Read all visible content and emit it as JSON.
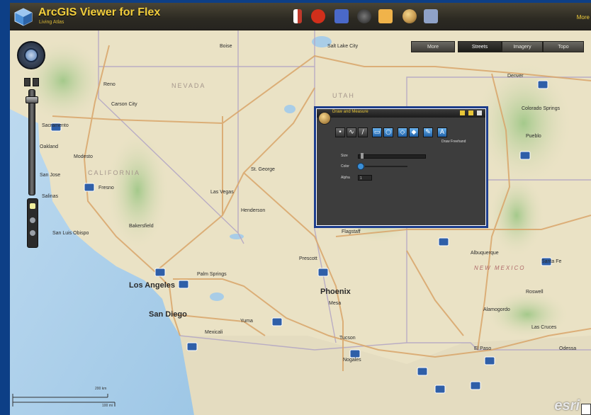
{
  "app": {
    "title": "ArcGIS Viewer for Flex",
    "subtitle": "Living Atlas",
    "header_more": "More"
  },
  "header_tools": [
    {
      "icon": "bookmark-icon",
      "color": "#c0392b"
    },
    {
      "icon": "record-icon",
      "color": "#d12f1b"
    },
    {
      "icon": "legend-icon",
      "color": "#4a69c9"
    },
    {
      "icon": "search-icon",
      "color": "#2d2d2d"
    },
    {
      "icon": "folder-icon",
      "color": "#f0b34a"
    },
    {
      "icon": "draw-globe-icon",
      "color": "#c79b52"
    },
    {
      "icon": "print-icon",
      "color": "#8fa2c8"
    }
  ],
  "basemaps": {
    "items": [
      "More",
      "Streets",
      "Imagery",
      "Topo"
    ],
    "active": "Streets"
  },
  "map_labels": [
    {
      "text": "Boise",
      "cls": "city"
    },
    {
      "text": "Salt Lake City",
      "cls": "city"
    },
    {
      "text": "Reno",
      "cls": "city"
    },
    {
      "text": "Carson City",
      "cls": "city"
    },
    {
      "text": "NEVADA",
      "cls": "state"
    },
    {
      "text": "UTAH",
      "cls": "state"
    },
    {
      "text": "Sacramento",
      "cls": "city"
    },
    {
      "text": "Oakland",
      "cls": "city"
    },
    {
      "text": "Modesto",
      "cls": "city"
    },
    {
      "text": "San Jose",
      "cls": "city"
    },
    {
      "text": "CALIFORNIA",
      "cls": "state"
    },
    {
      "text": "Fresno",
      "cls": "city"
    },
    {
      "text": "Salinas",
      "cls": "city"
    },
    {
      "text": "St. George",
      "cls": "city"
    },
    {
      "text": "Las Vegas",
      "cls": "city"
    },
    {
      "text": "Henderson",
      "cls": "city"
    },
    {
      "text": "Bakersfield",
      "cls": "city"
    },
    {
      "text": "San Luis Obispo",
      "cls": "city"
    },
    {
      "text": "Los Angeles",
      "cls": "big"
    },
    {
      "text": "Palm Springs",
      "cls": "city"
    },
    {
      "text": "San Diego",
      "cls": "big"
    },
    {
      "text": "Mexicali",
      "cls": "city"
    },
    {
      "text": "Yuma",
      "cls": "city"
    },
    {
      "text": "Prescott",
      "cls": "city"
    },
    {
      "text": "Flagstaff",
      "cls": "city"
    },
    {
      "text": "Phoenix",
      "cls": "big"
    },
    {
      "text": "Mesa",
      "cls": "city"
    },
    {
      "text": "Tucson",
      "cls": "city"
    },
    {
      "text": "Nogales",
      "cls": "city"
    },
    {
      "text": "Denver",
      "cls": "city"
    },
    {
      "text": "Colorado Springs",
      "cls": "city"
    },
    {
      "text": "Pueblo",
      "cls": "city"
    },
    {
      "text": "Albuquerque",
      "cls": "city"
    },
    {
      "text": "NEW MEXICO",
      "cls": "state-red"
    },
    {
      "text": "Santa Fe",
      "cls": "city"
    },
    {
      "text": "Roswell",
      "cls": "city"
    },
    {
      "text": "Alamogordo",
      "cls": "city"
    },
    {
      "text": "Las Cruces",
      "cls": "city"
    },
    {
      "text": "El Paso",
      "cls": "city"
    },
    {
      "text": "Odessa",
      "cls": "city"
    }
  ],
  "draw_widget": {
    "title": "Draw and Measure",
    "tools": [
      {
        "icon": "point-tool-icon",
        "glyph": "•"
      },
      {
        "icon": "polyline-tool-icon",
        "glyph": "∿"
      },
      {
        "icon": "line-tool-icon",
        "glyph": "/"
      },
      {
        "icon": "rectangle-tool-icon",
        "glyph": "▭"
      },
      {
        "icon": "circle-tool-icon",
        "glyph": "○"
      },
      {
        "icon": "ellipse-tool-icon",
        "glyph": "◇"
      },
      {
        "icon": "polygon-tool-icon",
        "glyph": "◆"
      },
      {
        "icon": "freehand-tool-icon",
        "glyph": "✎"
      },
      {
        "icon": "text-tool-icon",
        "glyph": "A"
      }
    ],
    "hint": "Draw Freehand",
    "size_label": "Size",
    "size_value": 0.04,
    "color_label": "Color",
    "alpha_label": "Alpha",
    "alpha_value": "1"
  },
  "scalebar": {
    "top_label": "200 km",
    "bottom_label": "100 mi"
  },
  "footer": {
    "logo_text": "esri"
  }
}
